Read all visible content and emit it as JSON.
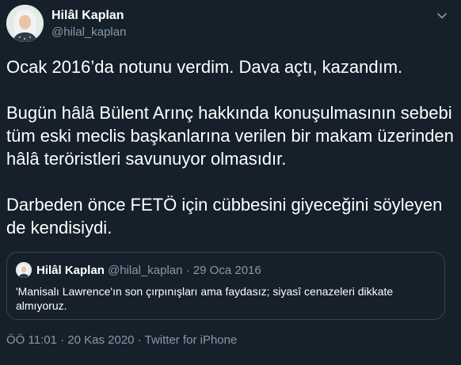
{
  "author": {
    "display_name": "Hilâl Kaplan",
    "handle": "@hilal_kaplan"
  },
  "icons": {
    "avatar": "avatar-icon",
    "more": "chevron-down-icon"
  },
  "tweet": {
    "paragraphs": [
      "Ocak 2016’da notunu verdim. Dava açtı, kazandım.",
      "Bugün hâlâ Bülent Arınç hakkında konuşulmasının sebebi tüm eski meclis başkanlarına verilen bir makam üzerinden hâlâ teröristleri savunuyor olmasıdır.",
      "Darbeden önce FETÖ için cübbesini giyeceğini söyleyen de kendisiydi."
    ]
  },
  "quoted": {
    "display_name": "Hilâl Kaplan",
    "handle": "@hilal_kaplan",
    "separator": "·",
    "date": "29 Oca 2016",
    "text": "'Manisalı Lawrence'ın son çırpınışları ama faydasız; siyasî cenazeleri dikkate almıyoruz."
  },
  "footer": {
    "time": "ÖÖ 11:01",
    "separator_1": "·",
    "date": "20 Kas 2020",
    "separator_2": "·",
    "source": "Twitter for iPhone"
  },
  "colors": {
    "background": "#15202b",
    "text": "#ffffff",
    "secondary": "#8899a6",
    "border": "#38444d"
  }
}
